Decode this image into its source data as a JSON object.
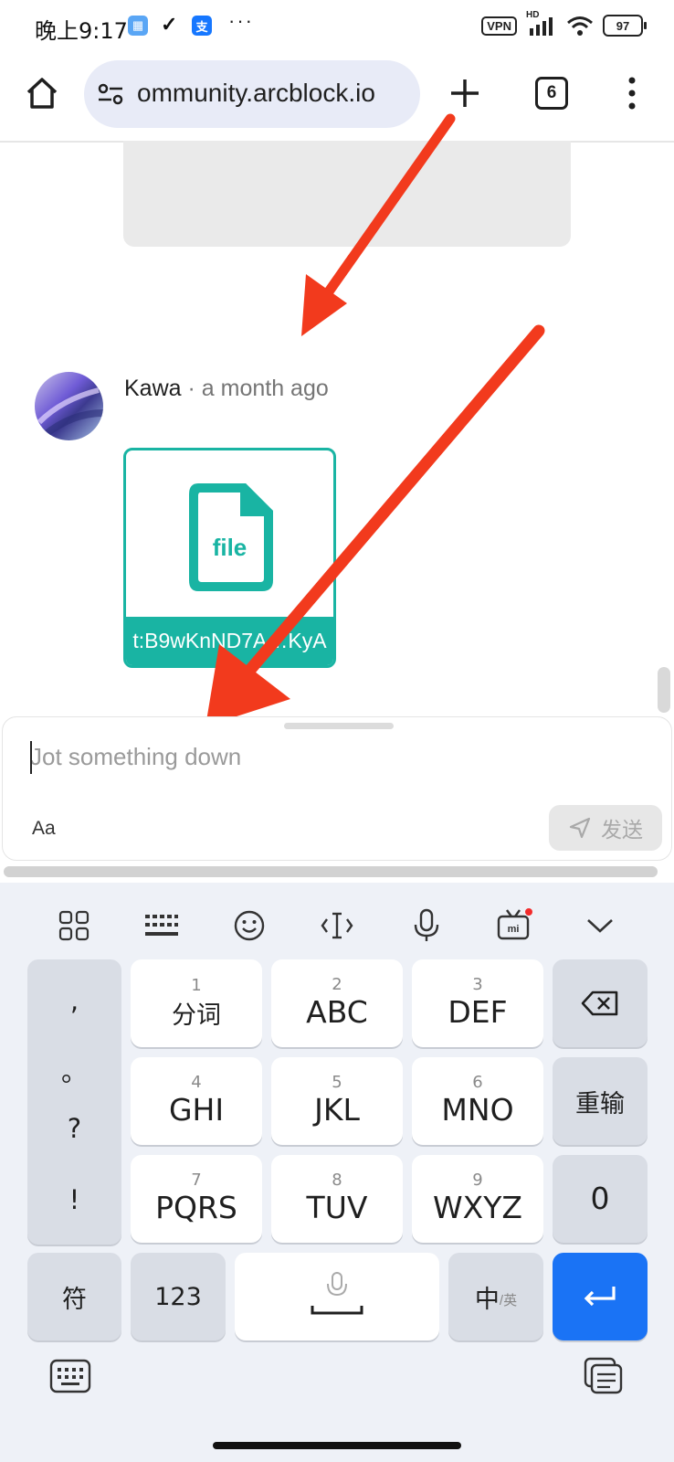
{
  "status_bar": {
    "time": "晚上9:17",
    "vpn": "VPN",
    "network": "HD",
    "battery": "97"
  },
  "browser": {
    "url": "ommunity.arcblock.io",
    "tab_count": "6"
  },
  "post": {
    "author": "Kawa",
    "separator": " · ",
    "time": "a month ago",
    "file_label": "file",
    "file_name": "t:B9wKnND7A…KyA"
  },
  "editor": {
    "placeholder": "Jot something down",
    "format_label": "Aa",
    "send_label": "发送"
  },
  "keyboard": {
    "punctuation": [
      ",",
      "。",
      "?",
      "!"
    ],
    "keys": [
      {
        "num": "1",
        "label": "分词"
      },
      {
        "num": "2",
        "label": "ABC"
      },
      {
        "num": "3",
        "label": "DEF"
      },
      {
        "num": "4",
        "label": "GHI"
      },
      {
        "num": "5",
        "label": "JKL"
      },
      {
        "num": "6",
        "label": "MNO"
      },
      {
        "num": "7",
        "label": "PQRS"
      },
      {
        "num": "8",
        "label": "TUV"
      },
      {
        "num": "9",
        "label": "WXYZ"
      }
    ],
    "reenter": "重输",
    "zero": "0",
    "symbols": "符",
    "numbers": "123",
    "lang_main": "中",
    "lang_sub": "/英"
  },
  "colors": {
    "accent_teal": "#19b4a3",
    "enter_blue": "#1a73f5",
    "arrow_red": "#f23a1d"
  }
}
